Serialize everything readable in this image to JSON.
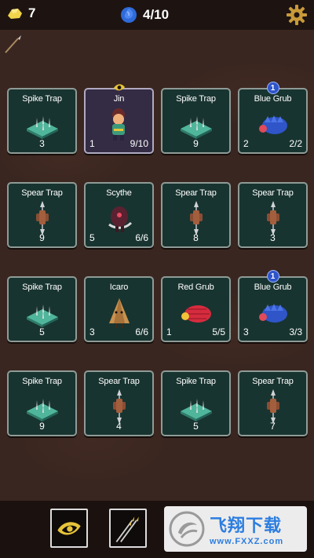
{
  "resources": {
    "gold": "7",
    "gems": "4/10"
  },
  "colors": {
    "card_bg": "#183430",
    "card_selected_bg": "#342c44",
    "gem": "#2f6ad9",
    "gold": "#f2d54b"
  },
  "cards": [
    {
      "name": "Spike Trap",
      "icon": "spike-trap-icon",
      "level": "3",
      "hp": ""
    },
    {
      "name": "Jin",
      "icon": "jin-character-icon",
      "level": "1",
      "hp": "9/10",
      "selected": true,
      "badge": "eye"
    },
    {
      "name": "Spike Trap",
      "icon": "spike-trap-icon",
      "level": "9",
      "hp": ""
    },
    {
      "name": "Blue Grub",
      "icon": "blue-grub-icon",
      "level": "2",
      "hp": "2/2",
      "badge": "1"
    },
    {
      "name": "Spear Trap",
      "icon": "spear-trap-icon",
      "level": "9",
      "hp": ""
    },
    {
      "name": "Scythe",
      "icon": "scythe-enemy-icon",
      "level": "5",
      "hp": "6/6"
    },
    {
      "name": "Spear Trap",
      "icon": "spear-trap-icon",
      "level": "8",
      "hp": ""
    },
    {
      "name": "Spear Trap",
      "icon": "spear-trap-icon",
      "level": "3",
      "hp": ""
    },
    {
      "name": "Spike Trap",
      "icon": "spike-trap-icon",
      "level": "5",
      "hp": ""
    },
    {
      "name": "Icaro",
      "icon": "icaro-enemy-icon",
      "level": "3",
      "hp": "6/6"
    },
    {
      "name": "Red Grub",
      "icon": "red-grub-icon",
      "level": "1",
      "hp": "5/5"
    },
    {
      "name": "Blue Grub",
      "icon": "blue-grub-icon",
      "level": "3",
      "hp": "3/3",
      "badge": "1"
    },
    {
      "name": "Spike Trap",
      "icon": "spike-trap-icon",
      "level": "9",
      "hp": ""
    },
    {
      "name": "Spear Trap",
      "icon": "spear-trap-icon",
      "level": "4",
      "hp": ""
    },
    {
      "name": "Spike Trap",
      "icon": "spike-trap-icon",
      "level": "5",
      "hp": ""
    },
    {
      "name": "Spear Trap",
      "icon": "spear-trap-icon",
      "level": "7",
      "hp": ""
    }
  ],
  "watermark": {
    "cn": "飞翔下载",
    "url": "www.FXXZ.com"
  }
}
